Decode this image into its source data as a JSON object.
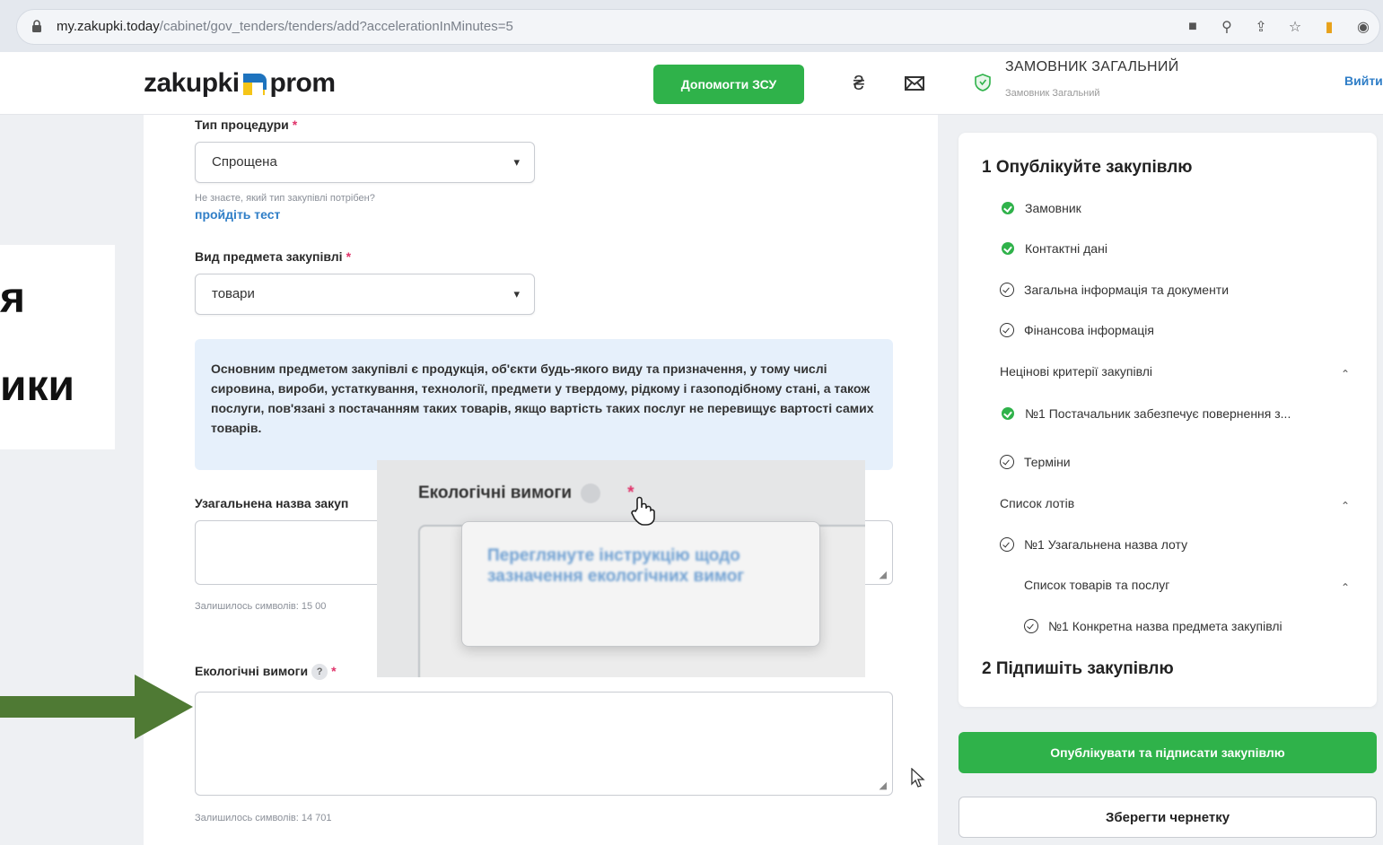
{
  "browser": {
    "url_host": "my.zakupki.today",
    "url_path": "/cabinet/gov_tenders/tenders/add?accelerationInMinutes=5"
  },
  "header": {
    "logo_left": "zakupki",
    "logo_right": "prom",
    "help_button": "Допомогти ЗСУ",
    "currency_icon": "₴",
    "org_name": "ЗАМОВНИК ЗАГАЛЬНИЙ",
    "org_sub": "Замовник Загальний",
    "logout": "Вийти"
  },
  "form": {
    "procedure_type_label": "Тип процедури",
    "procedure_type_value": "Спрощена",
    "procedure_hint": "Не знаєте, який тип закупівлі потрібен?",
    "procedure_test_link": "пройдіть тест",
    "subject_type_label": "Вид предмета закупівлі",
    "subject_type_value": "товари",
    "info_text": "Основним предметом закупівлі є продукція, об'єкти будь-якого виду та призначення, у тому числі сировина, вироби, устаткування, технології, предмети у твердому, рідкому і газоподібному стані, а також послуги, пов'язані з постачанням таких товарів, якщо вартість таких послуг не перевищує вартості самих товарів.",
    "general_name_label": "Узагальнена назва закуп",
    "general_name_counter": "Залишилось символів: 15 00",
    "eco_label": "Екологічні вимоги",
    "eco_counter": "Залишилось символів: 14 701",
    "required_mark": "*",
    "help_mark": "?"
  },
  "overlay": {
    "line1": "я",
    "line2": "ики"
  },
  "inset": {
    "label": "Екологічні вимоги",
    "tooltip": "Переглянуте інструкцію щодо зазначення екологічних вимог"
  },
  "sidebar": {
    "step1_title": "1  Опублікуйте закупівлю",
    "items": [
      {
        "label": "Замовник"
      },
      {
        "label": "Контактні дані"
      },
      {
        "label": "Загальна інформація та документи"
      },
      {
        "label": "Фінансова інформація"
      },
      {
        "label": "Нецінові критерії закупівлі"
      },
      {
        "label": "№1 Постачальник забезпечує повернення з..."
      },
      {
        "label": "Терміни"
      },
      {
        "label": "Список лотів"
      },
      {
        "label": "№1 Узагальнена назва лоту"
      },
      {
        "label": "Список товарів та послуг"
      },
      {
        "label": "№1 Конкретна назва предмета закупівлі"
      }
    ],
    "step2_title": "2  Підпишіть закупівлю",
    "publish_button": "Опублікувати та підписати закупівлю",
    "draft_button": "Зберегти чернетку"
  },
  "colors": {
    "accent_green": "#2fb24a",
    "link_blue": "#2f7ec7",
    "info_bg": "#e6f0fb",
    "arrow_green": "#4f7a34"
  }
}
